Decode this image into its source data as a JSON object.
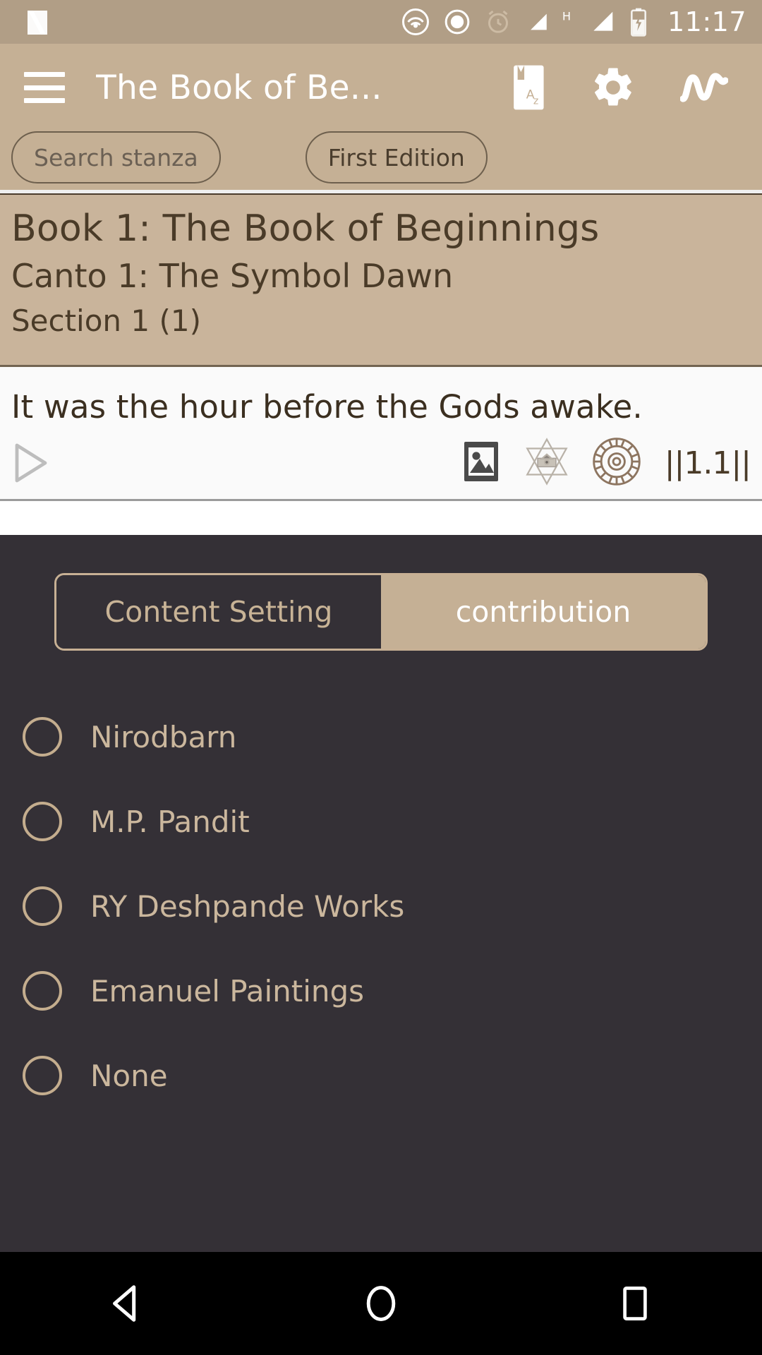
{
  "statusbar": {
    "time": "11:17",
    "icons": [
      "app-logo-n-icon",
      "cast-icon",
      "do-not-disturb-icon",
      "alarm-icon",
      "signal-icon",
      "hspa-icon",
      "signal-2-icon",
      "battery-charging-icon"
    ]
  },
  "appbar": {
    "menu_icon": "hamburger-menu-icon",
    "title": "The Book of Be...",
    "actions": [
      {
        "name": "dictionary-icon",
        "label": "Az"
      },
      {
        "name": "settings-gear-icon",
        "label": ""
      },
      {
        "name": "chart-line-icon",
        "label": ""
      }
    ]
  },
  "filters": {
    "search_chip": "Search stanza",
    "edition_chip": "First Edition"
  },
  "header": {
    "book": "Book 1: The Book of Beginnings",
    "canto": "Canto 1: The Symbol Dawn",
    "section": "Section 1 (1)"
  },
  "verse": {
    "text": "It was the hour before the Gods awake.",
    "play_icon": "play-triangle-icon",
    "tools": [
      {
        "name": "image-icon"
      },
      {
        "name": "star-hexagram-icon"
      },
      {
        "name": "lotus-wheel-icon"
      }
    ],
    "reference": "||1.1||"
  },
  "settings_panel": {
    "tabs": [
      {
        "label": "Content Setting",
        "selected": false
      },
      {
        "label": "contribution",
        "selected": true
      }
    ],
    "options": [
      {
        "label": "Nirodbarn",
        "selected": false
      },
      {
        "label": "M.P. Pandit",
        "selected": false
      },
      {
        "label": "RY Deshpande Works",
        "selected": false
      },
      {
        "label": "Emanuel Paintings",
        "selected": false
      },
      {
        "label": "None",
        "selected": false
      }
    ]
  },
  "navbar": {
    "back": "back-triangle-icon",
    "home": "home-circle-icon",
    "recents": "recents-square-icon"
  },
  "colors": {
    "status_bar": "#b19e86",
    "app_bar": "#c5b095",
    "header_block": "#c9b49b",
    "panel_dark": "#343036",
    "accent_tan": "#c5b095",
    "text_dark_brown": "#4a3b28",
    "label_tan": "#cbb79d"
  }
}
